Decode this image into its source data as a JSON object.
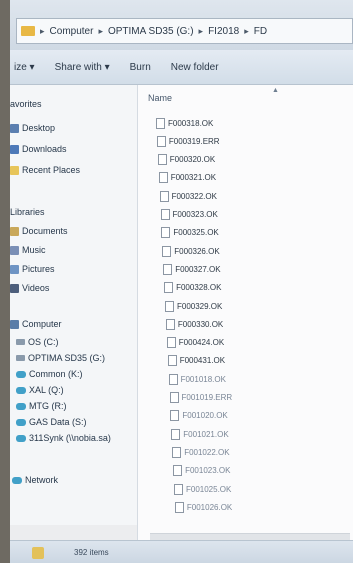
{
  "address": {
    "segments": [
      "Computer",
      "OPTIMA SD35 (G:)",
      "FI2018",
      "FD"
    ]
  },
  "toolbar": {
    "organize": "ize ▾",
    "share_with": "Share with ▾",
    "burn": "Burn",
    "new_folder": "New folder"
  },
  "nav": {
    "favorites": "avorites",
    "desktop": "Desktop",
    "downloads": "Downloads",
    "recent_places": "Recent Places",
    "libraries": "Libraries",
    "documents": "Documents",
    "music": "Music",
    "pictures": "Pictures",
    "videos": "Videos",
    "computer": "Computer",
    "drives": [
      "OS (C:)",
      "OPTIMA SD35 (G:)",
      "Common (K:)",
      "XAL (Q:)",
      "MTG (R:)",
      "GAS Data (S:)",
      "311Synk (\\\\nobia.sa)"
    ],
    "network": "Network"
  },
  "content": {
    "column_name": "Name",
    "files": [
      "F000318.OK",
      "F000319.ERR",
      "F000320.OK",
      "F000321.OK",
      "F000322.OK",
      "F000323.OK",
      "F000325.OK",
      "F000326.OK",
      "F000327.OK",
      "F000328.OK",
      "F000329.OK",
      "F000330.OK",
      "F000424.OK",
      "F000431.OK",
      "F001018.OK",
      "F001019.ERR",
      "F001020.OK",
      "F001021.OK",
      "F001022.OK",
      "F001023.OK",
      "F001025.OK",
      "F001026.OK"
    ]
  },
  "status": {
    "items": "392 items"
  }
}
